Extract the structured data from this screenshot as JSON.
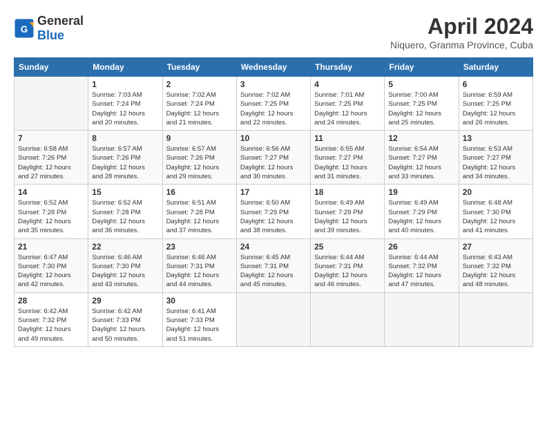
{
  "logo": {
    "text_general": "General",
    "text_blue": "Blue"
  },
  "title": {
    "month_year": "April 2024",
    "location": "Niquero, Granma Province, Cuba"
  },
  "days_of_week": [
    "Sunday",
    "Monday",
    "Tuesday",
    "Wednesday",
    "Thursday",
    "Friday",
    "Saturday"
  ],
  "weeks": [
    [
      {
        "day": "",
        "info": ""
      },
      {
        "day": "1",
        "info": "Sunrise: 7:03 AM\nSunset: 7:24 PM\nDaylight: 12 hours\nand 20 minutes."
      },
      {
        "day": "2",
        "info": "Sunrise: 7:02 AM\nSunset: 7:24 PM\nDaylight: 12 hours\nand 21 minutes."
      },
      {
        "day": "3",
        "info": "Sunrise: 7:02 AM\nSunset: 7:25 PM\nDaylight: 12 hours\nand 22 minutes."
      },
      {
        "day": "4",
        "info": "Sunrise: 7:01 AM\nSunset: 7:25 PM\nDaylight: 12 hours\nand 24 minutes."
      },
      {
        "day": "5",
        "info": "Sunrise: 7:00 AM\nSunset: 7:25 PM\nDaylight: 12 hours\nand 25 minutes."
      },
      {
        "day": "6",
        "info": "Sunrise: 6:59 AM\nSunset: 7:25 PM\nDaylight: 12 hours\nand 26 minutes."
      }
    ],
    [
      {
        "day": "7",
        "info": "Sunrise: 6:58 AM\nSunset: 7:26 PM\nDaylight: 12 hours\nand 27 minutes."
      },
      {
        "day": "8",
        "info": "Sunrise: 6:57 AM\nSunset: 7:26 PM\nDaylight: 12 hours\nand 28 minutes."
      },
      {
        "day": "9",
        "info": "Sunrise: 6:57 AM\nSunset: 7:26 PM\nDaylight: 12 hours\nand 29 minutes."
      },
      {
        "day": "10",
        "info": "Sunrise: 6:56 AM\nSunset: 7:27 PM\nDaylight: 12 hours\nand 30 minutes."
      },
      {
        "day": "11",
        "info": "Sunrise: 6:55 AM\nSunset: 7:27 PM\nDaylight: 12 hours\nand 31 minutes."
      },
      {
        "day": "12",
        "info": "Sunrise: 6:54 AM\nSunset: 7:27 PM\nDaylight: 12 hours\nand 33 minutes."
      },
      {
        "day": "13",
        "info": "Sunrise: 6:53 AM\nSunset: 7:27 PM\nDaylight: 12 hours\nand 34 minutes."
      }
    ],
    [
      {
        "day": "14",
        "info": "Sunrise: 6:52 AM\nSunset: 7:28 PM\nDaylight: 12 hours\nand 35 minutes."
      },
      {
        "day": "15",
        "info": "Sunrise: 6:52 AM\nSunset: 7:28 PM\nDaylight: 12 hours\nand 36 minutes."
      },
      {
        "day": "16",
        "info": "Sunrise: 6:51 AM\nSunset: 7:28 PM\nDaylight: 12 hours\nand 37 minutes."
      },
      {
        "day": "17",
        "info": "Sunrise: 6:50 AM\nSunset: 7:29 PM\nDaylight: 12 hours\nand 38 minutes."
      },
      {
        "day": "18",
        "info": "Sunrise: 6:49 AM\nSunset: 7:29 PM\nDaylight: 12 hours\nand 39 minutes."
      },
      {
        "day": "19",
        "info": "Sunrise: 6:49 AM\nSunset: 7:29 PM\nDaylight: 12 hours\nand 40 minutes."
      },
      {
        "day": "20",
        "info": "Sunrise: 6:48 AM\nSunset: 7:30 PM\nDaylight: 12 hours\nand 41 minutes."
      }
    ],
    [
      {
        "day": "21",
        "info": "Sunrise: 6:47 AM\nSunset: 7:30 PM\nDaylight: 12 hours\nand 42 minutes."
      },
      {
        "day": "22",
        "info": "Sunrise: 6:46 AM\nSunset: 7:30 PM\nDaylight: 12 hours\nand 43 minutes."
      },
      {
        "day": "23",
        "info": "Sunrise: 6:46 AM\nSunset: 7:31 PM\nDaylight: 12 hours\nand 44 minutes."
      },
      {
        "day": "24",
        "info": "Sunrise: 6:45 AM\nSunset: 7:31 PM\nDaylight: 12 hours\nand 45 minutes."
      },
      {
        "day": "25",
        "info": "Sunrise: 6:44 AM\nSunset: 7:31 PM\nDaylight: 12 hours\nand 46 minutes."
      },
      {
        "day": "26",
        "info": "Sunrise: 6:44 AM\nSunset: 7:32 PM\nDaylight: 12 hours\nand 47 minutes."
      },
      {
        "day": "27",
        "info": "Sunrise: 6:43 AM\nSunset: 7:32 PM\nDaylight: 12 hours\nand 48 minutes."
      }
    ],
    [
      {
        "day": "28",
        "info": "Sunrise: 6:42 AM\nSunset: 7:32 PM\nDaylight: 12 hours\nand 49 minutes."
      },
      {
        "day": "29",
        "info": "Sunrise: 6:42 AM\nSunset: 7:33 PM\nDaylight: 12 hours\nand 50 minutes."
      },
      {
        "day": "30",
        "info": "Sunrise: 6:41 AM\nSunset: 7:33 PM\nDaylight: 12 hours\nand 51 minutes."
      },
      {
        "day": "",
        "info": ""
      },
      {
        "day": "",
        "info": ""
      },
      {
        "day": "",
        "info": ""
      },
      {
        "day": "",
        "info": ""
      }
    ]
  ]
}
